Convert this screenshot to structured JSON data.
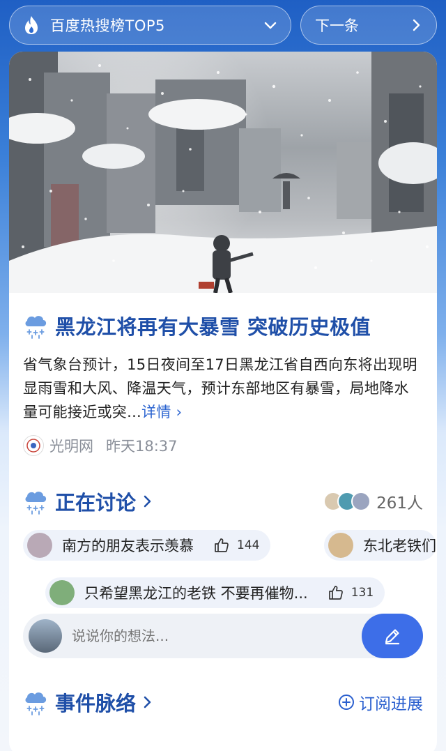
{
  "topbar": {
    "title": "百度热搜榜TOP5",
    "next_label": "下一条",
    "fire_icon": "fire-icon",
    "dropdown_icon": "chevron-down-icon",
    "next_icon": "chevron-right-icon"
  },
  "news": {
    "headline": "黑龙江将再有大暴雪 突破历史极值",
    "summary": "省气象台预计，15日夜间至17日黑龙江省自西向东将出现明显雨雪和大风、降温天气，预计东部地区有暴雪，局地降水量可能接近或突...",
    "more_label": "详情 ›",
    "source": "光明网",
    "time": "昨天18:37"
  },
  "discussion": {
    "title": "正在讨论",
    "participants": "261人",
    "comments": [
      {
        "text": "南方的朋友表示羡慕",
        "likes": "144"
      },
      {
        "text": "东北老铁们",
        "likes": ""
      },
      {
        "text": "只希望黑龙江的老铁 不要再催物...",
        "likes": "131"
      }
    ],
    "input_placeholder": "说说你的想法..."
  },
  "events": {
    "title": "事件脉络",
    "subscribe_label": "订阅进展"
  },
  "colors": {
    "accent": "#1f4fa8",
    "button": "#3d6ee8",
    "link": "#2a63d0"
  }
}
